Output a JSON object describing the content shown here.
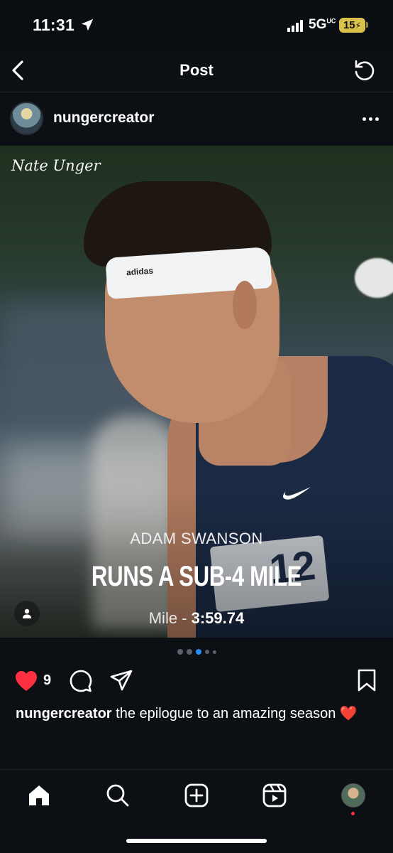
{
  "status_bar": {
    "time": "11:31",
    "network": "5G",
    "network_sup": "UC",
    "battery": "15"
  },
  "nav": {
    "title": "Post"
  },
  "post": {
    "username": "nungercreator",
    "photo": {
      "watermark": "Nate Unger",
      "athlete_name": "ADAM SWANSON",
      "headline": "RUNS A SUB-4 MILE",
      "result_event": "Mile - ",
      "result_time": "3:59.74",
      "bib_number": "12",
      "headband_brand": "adidas"
    },
    "carousel": {
      "total": 5,
      "active_index": 2
    },
    "likes": "9",
    "caption_user": "nungercreator",
    "caption_text": " the epilogue to an amazing season ❤️"
  },
  "icons": {
    "back": "chevron-left-icon",
    "refresh": "refresh-icon",
    "more": "more-horizontal-icon",
    "like": "heart-filled-icon",
    "comment": "comment-icon",
    "share": "send-icon",
    "save": "bookmark-icon",
    "tag": "person-tag-icon"
  },
  "colors": {
    "background": "#0c0f14",
    "like": "#ff3040",
    "active_dot": "#2d8cf0",
    "battery": "#d9c14a"
  },
  "tab_bar": {
    "items": [
      "home",
      "search",
      "create",
      "reels",
      "profile"
    ]
  }
}
